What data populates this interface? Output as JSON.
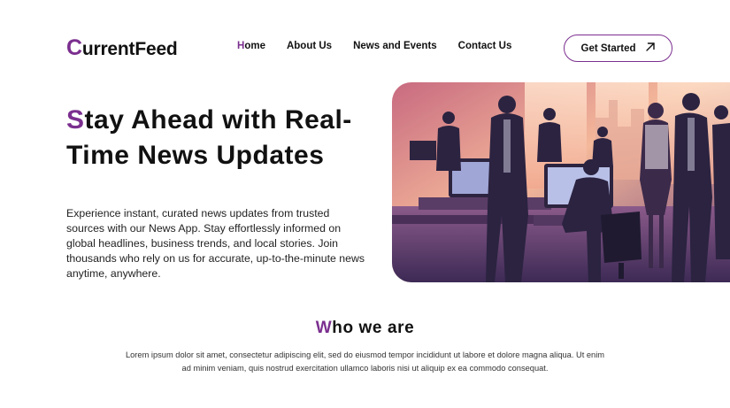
{
  "brand": {
    "first_letter": "C",
    "rest": "urrentFeed"
  },
  "nav": {
    "home_first": "H",
    "home_rest": "ome",
    "about": "About Us",
    "news": "News and Events",
    "contact": "Contact Us"
  },
  "cta": {
    "label": "Get Started",
    "icon": "arrow-up-right-icon"
  },
  "hero": {
    "title_first": "S",
    "title_rest": "tay Ahead with Real-Time News Updates",
    "text": "Experience instant, curated news updates from trusted sources with our News App. Stay effortlessly informed on global headlines, business trends, and local stories. Join thousands who rely on us for accurate, up-to-the-minute news anytime, anywhere."
  },
  "about": {
    "title_first": "W",
    "title_rest": "ho we are",
    "text": "Lorem ipsum dolor sit amet, consectetur adipiscing elit, sed do eiusmod tempor incididunt ut labore et dolore magna aliqua. Ut enim ad minim veniam, quis nostrud exercitation ullamco laboris nisi ut aliquip ex ea commodo consequat."
  },
  "colors": {
    "accent": "#7b2f8f",
    "text": "#111111"
  }
}
